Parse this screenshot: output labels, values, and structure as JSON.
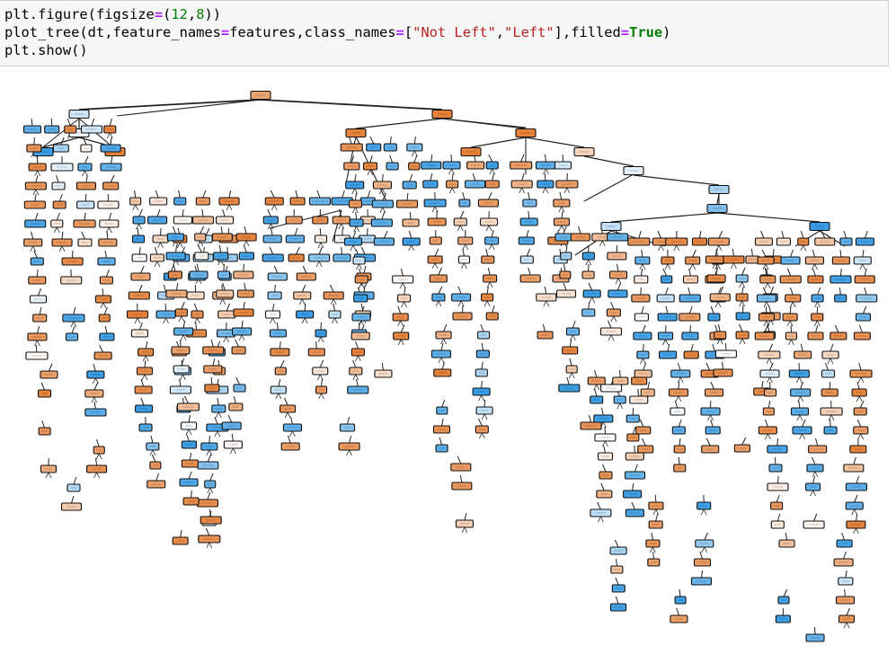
{
  "cell": {
    "line1": {
      "fn": "plt.figure",
      "open": "(",
      "arg_name": "figsize",
      "eq": "=",
      "tuple_open": "(",
      "w": "12",
      "comma": ",",
      "h": "8",
      "close": "))"
    },
    "line2": {
      "fn": "plot_tree(dt,feature_names",
      "eq1": "=",
      "features_part": "features,class_names",
      "eq2": "=",
      "list_open": "[",
      "class_0": "\"Not Left\"",
      "comma": ",",
      "class_1": "\"Left\"",
      "list_close": "],filled",
      "eq3": "=",
      "kw_true": "True",
      "close": ")"
    },
    "line3": {
      "text": "plt.show()"
    }
  },
  "output": {
    "type": "decision-tree-plot",
    "class_names": [
      "Not Left",
      "Left"
    ],
    "colors": {
      "class_0_fill": "#e58139",
      "class_1_fill": "#399de5",
      "edge": "#000000",
      "node_border": "#000000"
    }
  }
}
